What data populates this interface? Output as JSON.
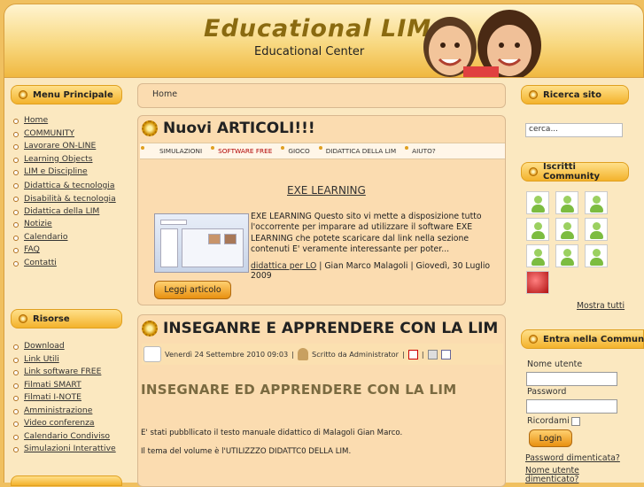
{
  "header": {
    "title": "Educational LIM",
    "subtitle": "Educational Center"
  },
  "menu_principale": {
    "title": "Menu Principale",
    "items": [
      "Home",
      "COMMUNITY",
      "Lavorare ON-LINE",
      "Learning Objects",
      "LIM e Discipline",
      "Didattica & tecnologia",
      "Disabilità & tecnologia",
      "Didattica della LIM",
      "Notizie",
      "Calendario",
      "FAQ",
      "Contatti"
    ]
  },
  "risorse": {
    "title": "Risorse",
    "items": [
      "Download",
      "Link Utili",
      "Link software FREE",
      "Filmati SMART",
      "Filmati I-NOTE",
      "Amministrazione",
      "Video conferenza",
      "Calendario Condiviso",
      "Simulazioni Interattive"
    ]
  },
  "breadcrumb": "Home",
  "nuovi": {
    "title": "Nuovi ARTICOLI!!!",
    "tabs": [
      "SIMULAZIONI",
      "SOFTWARE FREE",
      "GIOCO",
      "DIDATTICA DELLA LIM",
      "AIUTO?"
    ],
    "active_tab": "SOFTWARE FREE",
    "article_title": "EXE LEARNING",
    "text": "EXE LEARNING Questo sito vi mette a disposizione tutto l'occorrente per imparare ad utilizzare il software EXE LEARNING che potete scaricare dal link nella sezione contenuti  E' veramente interessante per poter...",
    "category": "didattica per LO",
    "meta": " | Gian Marco Malagoli | Giovedì, 30 Luglio 2009",
    "button": "Leggi articolo"
  },
  "article": {
    "title": "INSEGANRE E APPRENDERE CON LA LIM",
    "date": "Venerdì 24 Settembre 2010 09:03",
    "author": "Scritto da Administrator",
    "heading": "INSEGNARE ED APPRENDERE CON LA LIM",
    "p1": "E' stati pubbllicato il testo manuale didattico di Malagoli Gian Marco.",
    "p2": "Il tema del volume è l'UTILIZZZO DIDATTC0 DELLA LIM."
  },
  "ricerca": {
    "title": "Ricerca sito",
    "placeholder": "cerca..."
  },
  "iscritti": {
    "title": "Iscritti Community",
    "show_all": "Mostra tutti"
  },
  "login": {
    "title": "Entra nella Community",
    "username_label": "Nome utente",
    "password_label": "Password",
    "remember_label": "Ricordami",
    "button": "Login",
    "forgot_password": "Password dimenticata?",
    "forgot_username": "Nome utente dimenticato?"
  },
  "colors": {
    "accent": "#f3b22c",
    "background": "#fbdcb0",
    "active_tab": "#b00000"
  }
}
